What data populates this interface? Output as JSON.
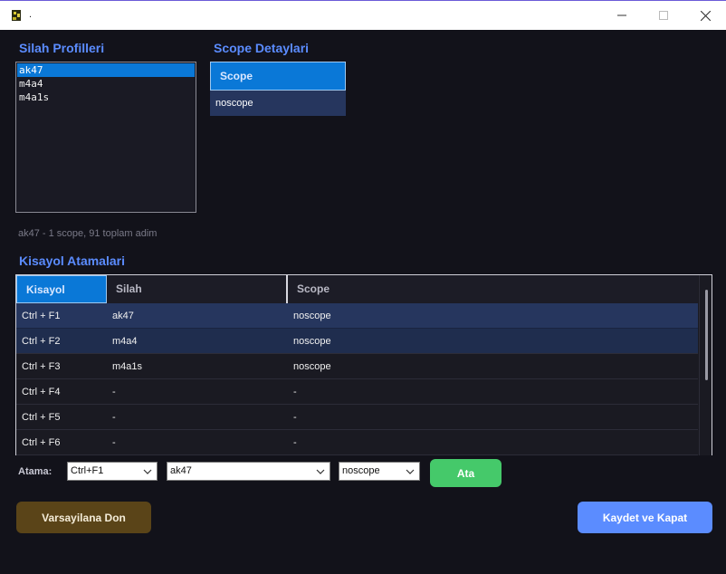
{
  "window": {
    "title": ".",
    "minimize_icon": "minimize-icon",
    "maximize_icon": "maximize-icon",
    "close_icon": "close-icon"
  },
  "profiles": {
    "title": "Silah Profilleri",
    "items": [
      "ak47",
      "m4a4",
      "m4a1s"
    ],
    "selected_index": 0
  },
  "scope_details": {
    "title": "Scope Detaylari",
    "header": "Scope",
    "rows": [
      "noscope"
    ]
  },
  "info": "ak47 - 1 scope, 91 toplam adim",
  "hotkeys": {
    "title": "Kisayol Atamalari",
    "columns": [
      "Kisayol",
      "Silah",
      "Scope"
    ],
    "rows": [
      [
        "Ctrl + F1",
        "ak47",
        "noscope"
      ],
      [
        "Ctrl + F2",
        "m4a4",
        "noscope"
      ],
      [
        "Ctrl + F3",
        "m4a1s",
        "noscope"
      ],
      [
        "Ctrl + F4",
        "-",
        "-"
      ],
      [
        "Ctrl + F5",
        "-",
        "-"
      ],
      [
        "Ctrl + F6",
        "-",
        "-"
      ]
    ]
  },
  "assign": {
    "label": "Atama:",
    "hotkey_value": "Ctrl+F1",
    "weapon_value": "ak47",
    "scope_value": "noscope",
    "button": "Ata"
  },
  "footer": {
    "default_button": "Varsayilana Don",
    "save_button": "Kaydet ve Kapat"
  },
  "colors": {
    "accent": "#5b8cff",
    "selection": "#0a78d7",
    "assign_button": "#45c96a",
    "default_button": "#5a4418"
  }
}
